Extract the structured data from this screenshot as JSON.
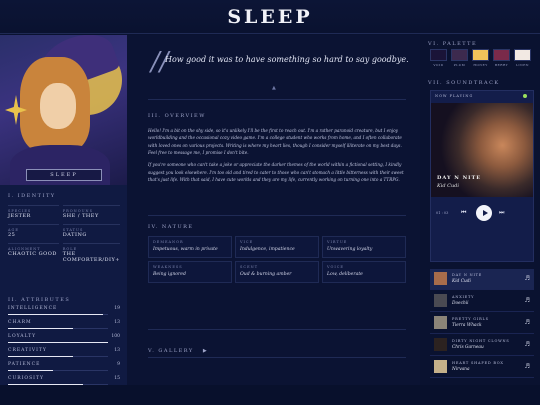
{
  "header": {
    "logo": "SLEEP"
  },
  "profile": {
    "name_tag": "SLEEP",
    "identity_title": "I. IDENTITY",
    "identity": [
      {
        "key": "SPECIES",
        "value": "JESTER"
      },
      {
        "key": "PRONOUNS",
        "value": "SHE / THEY"
      },
      {
        "key": "AGE",
        "value": "25"
      },
      {
        "key": "STATUS",
        "value": "DATING"
      },
      {
        "key": "ALIGNMENT",
        "value": "CHAOTIC GOOD"
      },
      {
        "key": "ROLE",
        "value": "THE COMFORTER/DIY+"
      }
    ],
    "attributes_title": "II. ATTRIBUTES",
    "attributes": [
      {
        "name": "INTELLIGENCE",
        "value": 19,
        "max": 20
      },
      {
        "name": "CHARM",
        "value": 13,
        "max": 20
      },
      {
        "name": "LOYALTY",
        "value": 100,
        "max": 100
      },
      {
        "name": "CREATIVITY",
        "value": 13,
        "max": 20
      },
      {
        "name": "PATIENCE",
        "value": 9,
        "max": 20
      },
      {
        "name": "CURIOSITY",
        "value": 15,
        "max": 20
      }
    ]
  },
  "main": {
    "quote": "How good it was to have something so hard to say goodbye.",
    "divider_glyph": "▲",
    "overview_title": "III. OVERVIEW",
    "overview_paragraphs": [
      "Hello! I'm a bit on the shy side, so it's unlikely I'll be the first to reach out. I'm a rather paranoid creature, but I enjoy worldbuilding and the occasional cozy video game. I'm a college student who works from home, and I often collaborate with loved ones on various projects. Writing is where my heart lies, though I consider myself illiterate on my best days. Feel free to message me, I promise I don't bite.",
      "If you're someone who can't take a joke or appreciate the darker themes of the world within a fictional setting, I kindly suggest you look elsewhere. I'm too old and tired to cater to those who can't stomach a little bitterness with their sweet that's just life. With that said, I have cute worlds and they are my life, currently working on turning one into a TTRPG."
    ],
    "nature_title": "IV. NATURE",
    "nature": [
      {
        "key": "DEMEANOR",
        "value": "Impetuous, warm in private"
      },
      {
        "key": "VICE",
        "value": "Indulgence, impatience"
      },
      {
        "key": "VIRTUE",
        "value": "Unwavering loyalty"
      },
      {
        "key": "WEAKNESS",
        "value": "Being ignored"
      },
      {
        "key": "SCENT",
        "value": "Oud & burning amber"
      },
      {
        "key": "VOICE",
        "value": "Low, deliberate"
      }
    ],
    "gallery_title": "V. GALLERY",
    "gallery_arrow": "▶"
  },
  "sidebar": {
    "palette_title": "VI. PALETTE",
    "palette": [
      {
        "label": "VOID",
        "color": "#1a1438"
      },
      {
        "label": "PLUM",
        "color": "#3d2a4e"
      },
      {
        "label": "HONEY",
        "color": "#f0c35a"
      },
      {
        "label": "BERRY",
        "color": "#7a2a4a"
      },
      {
        "label": "LINEN",
        "color": "#f2e9e3"
      }
    ],
    "soundtrack_title": "VII. SOUNDTRACK",
    "now_playing_label": "NOW PLAYING",
    "current": {
      "title": "DAY N NITE",
      "artist": "Kid Cudi"
    },
    "time_current": "01 : 03",
    "prev_glyph": "⏮",
    "next_glyph": "⏭",
    "tracks": [
      {
        "title": "DAY N NITE",
        "artist": "Kid Cudi",
        "color": "#a86c4b",
        "note": "♬"
      },
      {
        "title": "ANXIETY",
        "artist": "Doechii",
        "color": "#4a4a52",
        "note": "♬"
      },
      {
        "title": "PRETTY GIRLS",
        "artist": "Tierra Whack",
        "color": "#8b8478",
        "note": "♬"
      },
      {
        "title": "DIRTY NIGHT CLOWNS",
        "artist": "Chris Garneau",
        "color": "#2c2220",
        "note": "♬"
      },
      {
        "title": "HEART SHAPED BOX",
        "artist": "Nirvana",
        "color": "#c4b08a",
        "note": "♬"
      }
    ]
  }
}
